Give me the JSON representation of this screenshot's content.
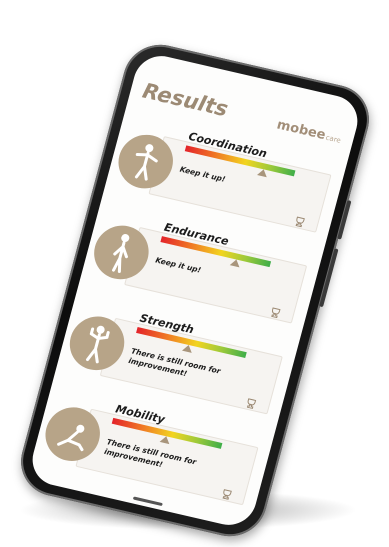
{
  "header": {
    "title": "Results",
    "logo_main": "mobee",
    "logo_sub": "care"
  },
  "results": [
    {
      "label": "Coordination",
      "message": "Keep it up!",
      "level": 0.72,
      "figure": "coordination-figure-icon"
    },
    {
      "label": "Endurance",
      "message": "Keep it up!",
      "level": 0.7,
      "figure": "endurance-figure-icon"
    },
    {
      "label": "Strength",
      "message": "There is still room for improvement!",
      "level": 0.48,
      "figure": "strength-figure-icon"
    },
    {
      "label": "Mobility",
      "message": "There is still room for improvement!",
      "level": 0.5,
      "figure": "mobility-figure-icon"
    }
  ],
  "colors": {
    "accent": "#b7a488",
    "title": "#9c8a74",
    "bar_low": "#e3232a",
    "bar_high": "#3fae49"
  }
}
